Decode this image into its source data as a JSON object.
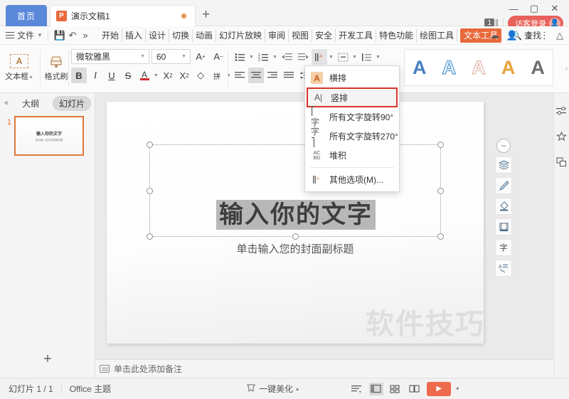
{
  "titlebar": {
    "home_tab": "首页",
    "doc_tab": {
      "icon": "powerpoint-icon",
      "icon_letter": "P",
      "label": "演示文稿1"
    },
    "new_tab": "+",
    "window": {
      "minimize": "—",
      "maximize": "▢",
      "close": "✕"
    },
    "count": "1",
    "login": {
      "label": "访客登录",
      "avatar_icon": "user-avatar-icon"
    }
  },
  "menubar": {
    "file_label": "文件",
    "save_icon": "save-icon",
    "undo_icon": "undo-icon",
    "more_icon": "»",
    "tabs": [
      "开始",
      "插入",
      "设计",
      "切换",
      "动画",
      "幻灯片放映",
      "审阅",
      "视图",
      "安全",
      "开发工具",
      "特色功能",
      "绘图工具"
    ],
    "active_tab": "文本工具",
    "find_label": "查找",
    "right_icons": [
      "cloud-icon",
      "share-user-icon",
      "upload-icon",
      "more-vert-icon",
      "collapse-ribbon-icon"
    ]
  },
  "ribbon": {
    "textbox_button": {
      "label": "文本框",
      "icon": "textbox-icon",
      "glyph": "A"
    },
    "format_painter": {
      "label": "格式刷",
      "icon": "format-painter-icon"
    },
    "font_name": "微软雅黑",
    "font_size": "60",
    "grow_font_icon": "A⁺",
    "shrink_font_icon": "A⁻",
    "bold": "B",
    "italic": "I",
    "underline": "U",
    "strikethrough": "S",
    "font_color": "A",
    "font_color_hex": "#cf2d2d",
    "superscript": "X²",
    "subscript": "X₂",
    "clear_format": "clear-format-icon",
    "pinyin": "拼音",
    "paragraph_icons": [
      "bullet-list-icon",
      "numbered-list-icon",
      "decrease-indent-icon",
      "increase-indent-icon",
      "text-direction-icon",
      "align-text-icon",
      "columns-icon"
    ],
    "align_icons": [
      "align-left-icon",
      "align-center-icon",
      "align-right-icon",
      "justify-icon",
      "line-spacing-icon"
    ],
    "wordart_styles": [
      "A",
      "A",
      "A",
      "A",
      "A"
    ],
    "wordart_more": "›"
  },
  "dropdown": {
    "items": [
      {
        "label": "横排",
        "icon": "horizontal-text-icon",
        "selected": false,
        "highlighted_icon": true
      },
      {
        "label": "竖排",
        "icon": "vertical-text-icon",
        "selected": true,
        "highlighted_icon": false
      },
      {
        "label": "所有文字旋转90°",
        "icon": "rotate-90-icon",
        "selected": false,
        "highlighted_icon": false
      },
      {
        "label": "所有文字旋转270°",
        "icon": "rotate-270-icon",
        "selected": false,
        "highlighted_icon": false
      },
      {
        "label": "堆积",
        "icon": "stacked-text-icon",
        "selected": false,
        "highlighted_icon": false
      },
      {
        "label": "其他选项(M)...",
        "icon": "more-options-icon",
        "selected": false,
        "highlighted_icon": false
      }
    ],
    "selection_border_hex": "#d9342b"
  },
  "sidebar": {
    "collapse_icon": "«",
    "tab_outline": "大纲",
    "tab_slides": "幻灯片",
    "slides": [
      {
        "number": "1",
        "title": "输入你的文字",
        "subtitle": "单击输入您的封面副标题"
      }
    ],
    "add_slide": "+"
  },
  "slide": {
    "title": "输入你的文字",
    "subtitle": "单击输入您的封面副标题",
    "watermark": "软件技巧",
    "float_tools": [
      "minus-circle-icon",
      "layers-icon",
      "brush-icon",
      "fill-icon",
      "shape-icon",
      "text-icon",
      "text-effects-icon"
    ]
  },
  "right_rail": {
    "icons": [
      "settings-sliders-icon",
      "effects-star-icon",
      "duplicate-shapes-icon"
    ]
  },
  "notes": {
    "placeholder": "单击此处添加备注",
    "icon": "note-icon"
  },
  "statusbar": {
    "slide_count": "幻灯片 1 / 1",
    "theme": "Office 主题",
    "beautify": "一键美化",
    "beautify_icon": "magic-wand-icon",
    "beautify_caret": "▴",
    "view_icons": [
      "notes-view-icon",
      "normal-view-icon",
      "slide-sorter-icon",
      "reading-view-icon"
    ],
    "play_icon": "▶",
    "play_caret": "▾"
  }
}
